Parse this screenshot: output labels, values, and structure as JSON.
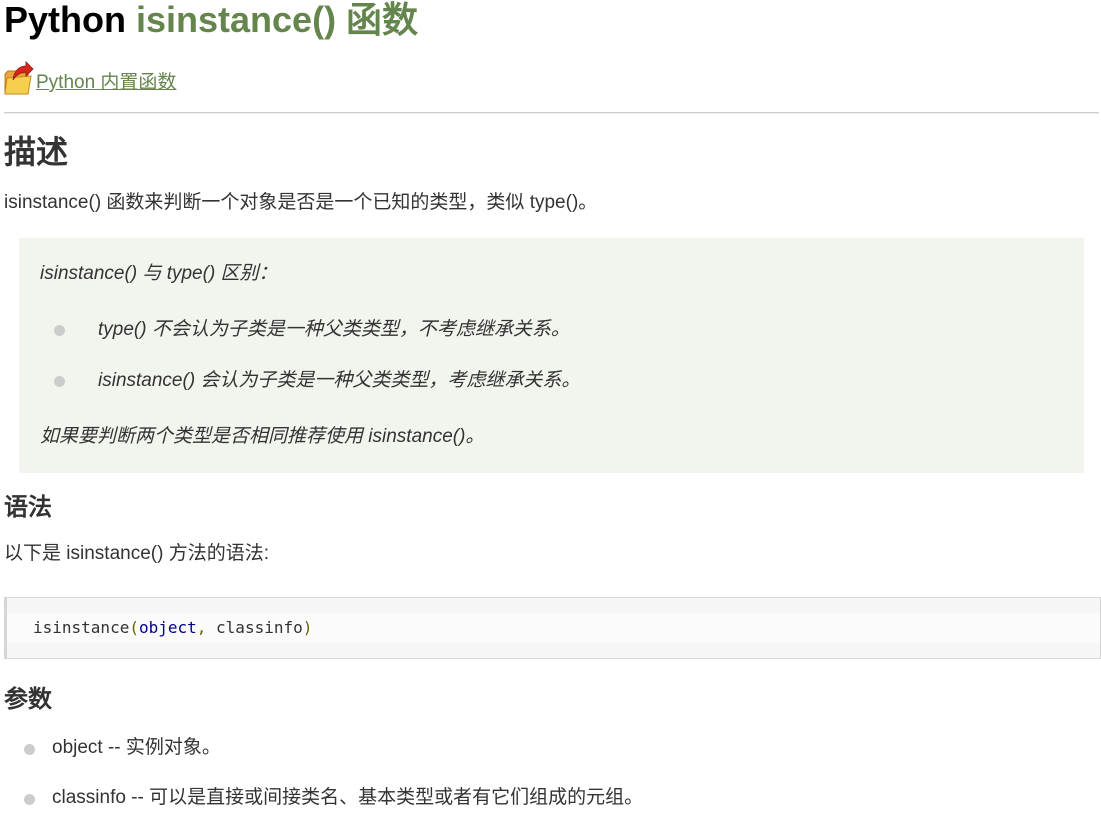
{
  "title": {
    "prefix": "Python ",
    "func": "isinstance() 函数"
  },
  "backlink": {
    "icon": "folder-up-icon",
    "label": " Python 内置函数"
  },
  "description": {
    "heading": "描述",
    "text": "isinstance() 函数来判断一个对象是否是一个已知的类型，类似 type()。"
  },
  "note": {
    "intro": "isinstance() 与 type() 区别：",
    "items": [
      "type() 不会认为子类是一种父类类型，不考虑继承关系。",
      "isinstance() 会认为子类是一种父类类型，考虑继承关系。"
    ],
    "conclusion": "如果要判断两个类型是否相同推荐使用 isinstance()。"
  },
  "syntax": {
    "heading": "语法",
    "text": "以下是 isinstance() 方法的语法:",
    "code": {
      "fn": "isinstance",
      "open": "(",
      "arg1": "object",
      "comma": ",",
      "arg2": " classinfo",
      "close": ")"
    }
  },
  "params": {
    "heading": "参数",
    "items": [
      "object -- 实例对象。",
      "classinfo -- 可以是直接或间接类名、基本类型或者有它们组成的元组。"
    ]
  },
  "colors": {
    "accent": "#64854c",
    "note_bg": "#f2f5ee",
    "bullet": "#cccccc"
  }
}
